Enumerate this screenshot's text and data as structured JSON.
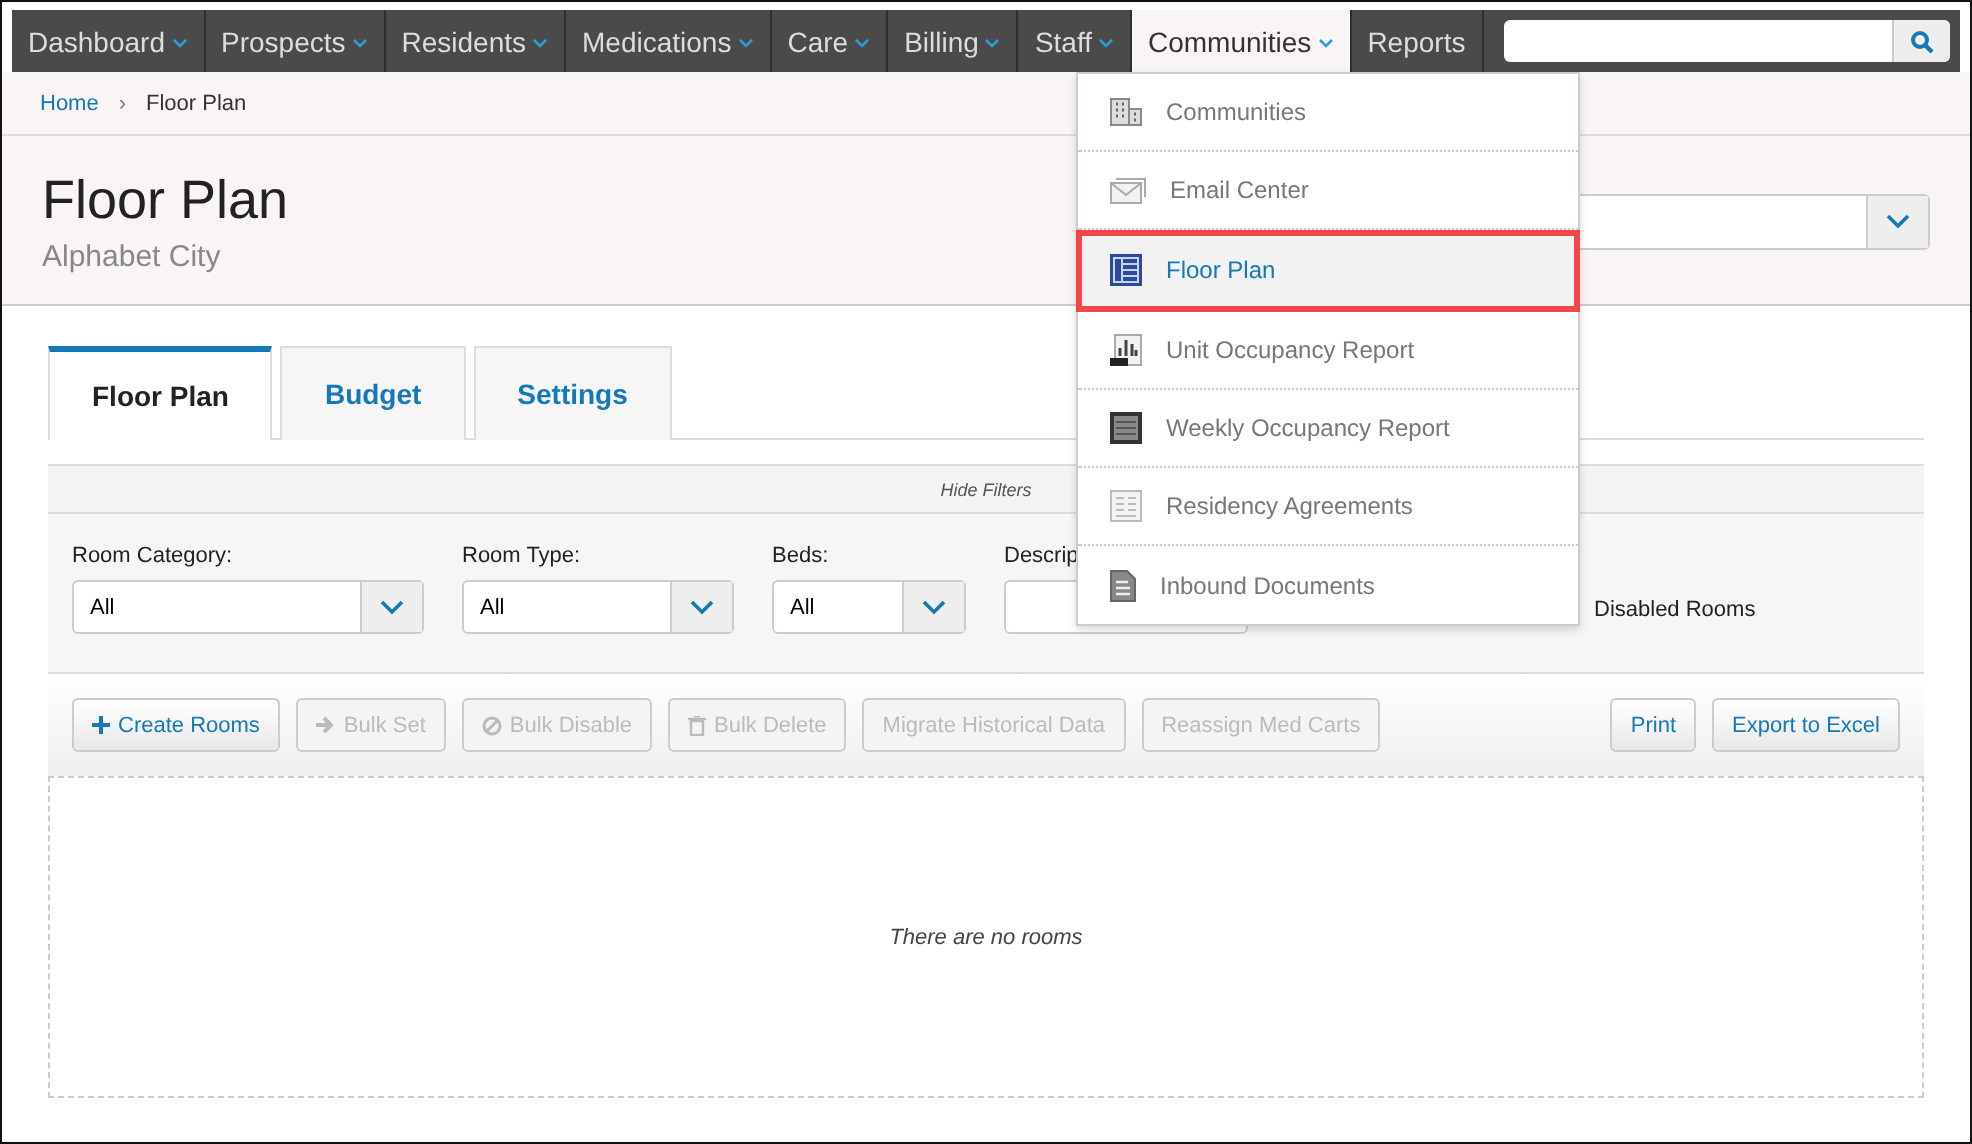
{
  "nav": [
    {
      "label": "Dashboard",
      "caret": true,
      "selected": false
    },
    {
      "label": "Prospects",
      "caret": true,
      "selected": false
    },
    {
      "label": "Residents",
      "caret": true,
      "selected": false
    },
    {
      "label": "Medications",
      "caret": true,
      "selected": false
    },
    {
      "label": "Care",
      "caret": true,
      "selected": false
    },
    {
      "label": "Billing",
      "caret": true,
      "selected": false
    },
    {
      "label": "Staff",
      "caret": true,
      "selected": false
    },
    {
      "label": "Communities",
      "caret": true,
      "selected": true
    },
    {
      "label": "Reports",
      "caret": false,
      "selected": false
    }
  ],
  "breadcrumb": {
    "home": "Home",
    "separator": "›",
    "current": "Floor Plan"
  },
  "header": {
    "title": "Floor Plan",
    "subtitle": "Alphabet City"
  },
  "tabs": [
    {
      "label": "Floor Plan",
      "selected": true
    },
    {
      "label": "Budget",
      "selected": false
    },
    {
      "label": "Settings",
      "selected": false
    }
  ],
  "filters": {
    "toggle": "Hide Filters",
    "fields": [
      {
        "label": "Room Category:",
        "value": "All",
        "kind": "select"
      },
      {
        "label": "Room Type:",
        "value": "All",
        "kind": "select"
      },
      {
        "label": "Beds:",
        "value": "All",
        "kind": "select"
      },
      {
        "label": "Descrip",
        "kind": "text"
      }
    ],
    "checkbox_label": "Disabled Rooms"
  },
  "toolbar": [
    {
      "label": "Create Rooms",
      "kind": "plus",
      "disabled": false
    },
    {
      "label": "Bulk Set",
      "kind": "arrow",
      "disabled": true
    },
    {
      "label": "Bulk Disable",
      "kind": "ban",
      "disabled": true
    },
    {
      "label": "Bulk Delete",
      "kind": "trash",
      "disabled": true
    },
    {
      "label": "Migrate Historical Data",
      "kind": "text",
      "disabled": true
    },
    {
      "label": "Reassign Med Carts",
      "kind": "text",
      "disabled": true
    }
  ],
  "toolbar_right": [
    "Print",
    "Export to Excel"
  ],
  "empty_message": "There are no rooms",
  "menu": [
    {
      "label": "Communities",
      "kind": "buildings",
      "selected": false
    },
    {
      "label": "Email Center",
      "kind": "envelope",
      "selected": false
    },
    {
      "label": "Floor Plan",
      "kind": "floorplan",
      "selected": true
    },
    {
      "label": "Unit Occupancy Report",
      "kind": "chart",
      "selected": false
    },
    {
      "label": "Weekly Occupancy Report",
      "kind": "ledger",
      "selected": false
    },
    {
      "label": "Residency Agreements",
      "kind": "form",
      "selected": false
    },
    {
      "label": "Inbound Documents",
      "kind": "document",
      "selected": false
    }
  ]
}
